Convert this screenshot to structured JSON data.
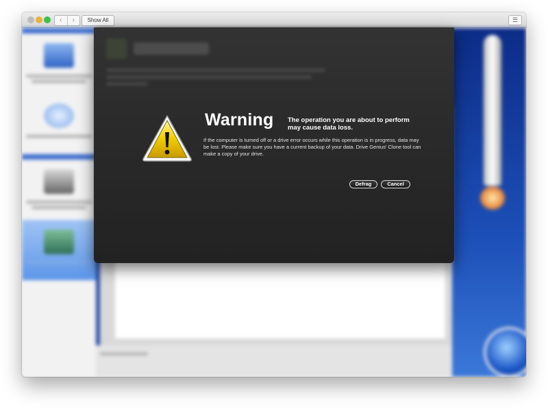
{
  "toolbar": {
    "back_glyph": "‹",
    "forward_glyph": "›",
    "show_all_label": "Show All",
    "list_glyph": "☰"
  },
  "colors": {
    "sheet_bg": "#2b2b2b",
    "sidebar_selection": "#5d95e8",
    "right_panel_blue": "#1c4fb8",
    "warning_yellow": "#f3d100"
  },
  "dialog": {
    "title": "Warning",
    "subtitle": "The operation you are about to perform may cause data loss.",
    "body": "If the computer is turned off or a drive error occurs while this operation is in progress, data may be lost. Please make sure you have a current backup of your data. Drive Genius' Clone tool can make a copy of your drive.",
    "icon": "warning-icon",
    "buttons": {
      "defrag_label": "Defrag",
      "cancel_label": "Cancel"
    }
  }
}
